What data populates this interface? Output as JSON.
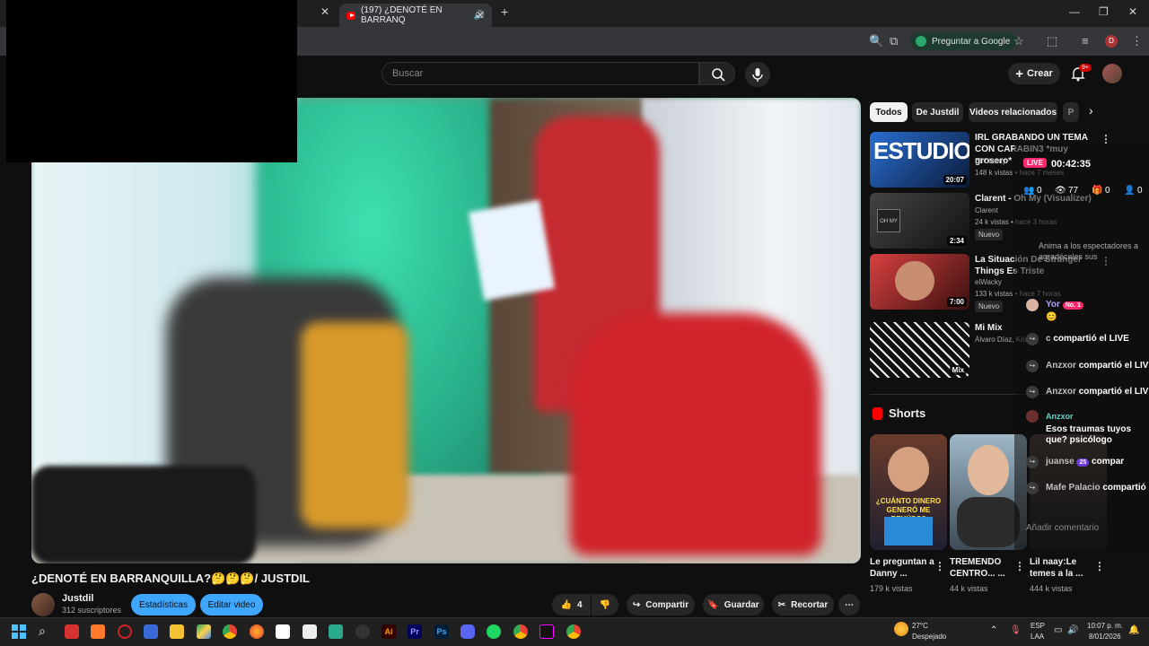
{
  "browser": {
    "active_tab_title": "(197) ¿DENOTÉ EN BARRANQ",
    "new_tab_label": "+",
    "ask_google": "Preguntar a Google",
    "profile_initial": "D"
  },
  "youtube": {
    "search_placeholder": "Buscar",
    "create_label": "Crear",
    "notif_badge": "9+"
  },
  "video": {
    "title": "¿DENOTÉ EN BARRANQUILLA?🤔🤔🤔/ JUSTDIL",
    "channel": "Justdil",
    "subscribers": "312 suscriptores",
    "stats_button": "Estadísticas",
    "edit_button": "Editar video",
    "likes": "4",
    "share": "Compartir",
    "save": "Guardar",
    "clip": "Recortar"
  },
  "chips": [
    "Todos",
    "De Justdil",
    "Videos relacionados",
    "P"
  ],
  "recommendations": [
    {
      "title": "IRL GRABANDO UN TEMA CON CARABIN3 *muy grosero*",
      "channel": "El Chanty",
      "views": "148 k vistas • hace 7 meses",
      "duration": "20:07",
      "new": ""
    },
    {
      "title": "Clarent - Oh My (Visualizer)",
      "channel": "Clarent",
      "views": "24 k vistas • hace 3 horas",
      "duration": "2:34",
      "new": "Nuevo"
    },
    {
      "title": "La Situación De Stranger Things Es Triste",
      "channel": "elWacky",
      "views": "133 k vistas • hace 7 horas",
      "duration": "7:00",
      "new": "Nuevo"
    },
    {
      "title": "Mi Mix",
      "channel": "Álvaro Díaz, Kris...",
      "views": "",
      "duration": "Mix",
      "new": ""
    }
  ],
  "shorts": {
    "label": "Shorts",
    "items": [
      {
        "title": "Le preguntan a Danny ...",
        "views": "179 k vistas",
        "overlay": "¿CUÁNTO DINERO GENERÓ ME REHÚSO?"
      },
      {
        "title": "TREMENDO CENTRO... ...",
        "views": "44 k vistas",
        "overlay": ""
      },
      {
        "title": "Lil naay:Le temes a la ...",
        "views": "444 k vistas",
        "overlay": ""
      }
    ]
  },
  "live": {
    "badge": "LIVE",
    "timer": "00:42:35",
    "stats": [
      "0",
      "77",
      "0",
      "0"
    ],
    "prompt": "Anima a los espectadores a agradéceles sus",
    "events": [
      {
        "name": "Yor",
        "badge": "No. 1",
        "text": "😊"
      },
      {
        "name": "c",
        "text": "compartió el LIVE"
      },
      {
        "name": "Anzxor",
        "text": "compartió el LIVE"
      },
      {
        "name": "Anzxor",
        "text": "compartió el LIVE"
      },
      {
        "name": "Anzxor",
        "text": "Esos traumas tuyos que? psicólogo"
      },
      {
        "name": "juanse",
        "badge": "25",
        "text": "compar"
      },
      {
        "name": "Mafe Palacio",
        "text": "compartió"
      }
    ],
    "comment_placeholder": "Añadir comentario"
  },
  "taskbar": {
    "temp": "27°C",
    "weather": "Despejado",
    "lang1": "ESP",
    "lang2": "LAA",
    "time": "10:07 p. m.",
    "date": "8/01/2026"
  }
}
